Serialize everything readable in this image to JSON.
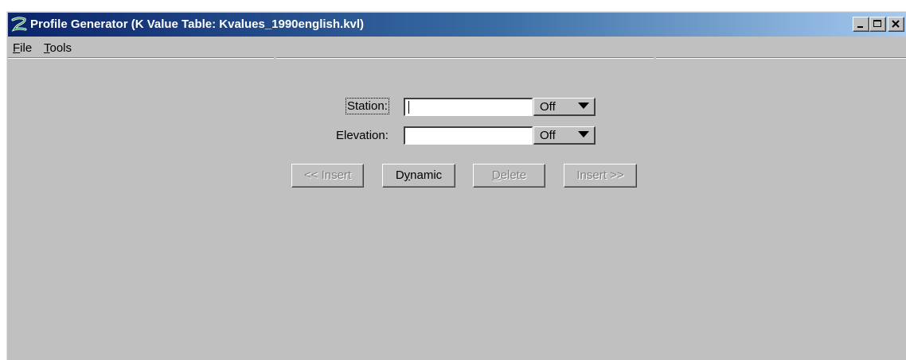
{
  "window": {
    "title": "Profile Generator  (K Value Table: Kvalues_1990english.kvl)",
    "icon": "profile-generator-app-icon",
    "caption_buttons": [
      "minimize",
      "maximize",
      "close"
    ]
  },
  "menu": {
    "items": [
      {
        "label": "File",
        "mnemonic": "F",
        "rest": "ile"
      },
      {
        "label": "Tools",
        "mnemonic": "T",
        "rest": "ools"
      }
    ]
  },
  "form": {
    "station": {
      "label": "Station:",
      "value": "",
      "mode": "Off"
    },
    "elevation": {
      "label": "Elevation:",
      "value": "",
      "mode": "Off"
    }
  },
  "buttons": {
    "insert_before": {
      "label": "<< Insert",
      "enabled": false
    },
    "dynamic": {
      "label": "Dynamic",
      "mnemonic": "y",
      "prefix": "D",
      "suffix": "namic",
      "enabled": true
    },
    "delete": {
      "label": "Delete",
      "mnemonic": "D",
      "rest": "elete",
      "enabled": false
    },
    "insert_after": {
      "label": "Insert >>",
      "enabled": false
    }
  },
  "colors": {
    "title_gradient_start": "#0a246a",
    "title_gradient_end": "#a6caf0",
    "window_face": "#c0c0c0"
  }
}
